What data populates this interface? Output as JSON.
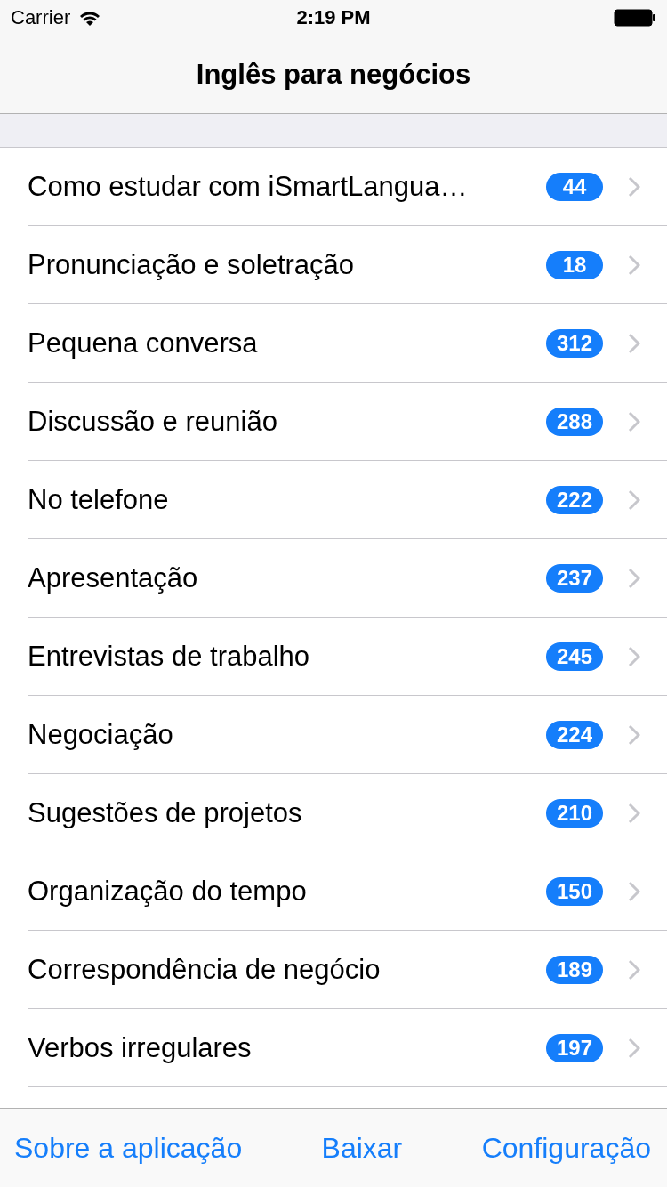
{
  "status_bar": {
    "carrier": "Carrier",
    "time": "2:19 PM"
  },
  "nav_bar": {
    "title": "Inglês para negócios"
  },
  "list": [
    {
      "label": "Como estudar com iSmartLangua…",
      "count": "44"
    },
    {
      "label": "Pronunciação e soletração",
      "count": "18"
    },
    {
      "label": "Pequena conversa",
      "count": "312"
    },
    {
      "label": "Discussão e reunião",
      "count": "288"
    },
    {
      "label": "No telefone",
      "count": "222"
    },
    {
      "label": "Apresentação",
      "count": "237"
    },
    {
      "label": "Entrevistas de trabalho",
      "count": "245"
    },
    {
      "label": "Negociação",
      "count": "224"
    },
    {
      "label": "Sugestões de projetos",
      "count": "210"
    },
    {
      "label": "Organização do tempo",
      "count": "150"
    },
    {
      "label": "Correspondência de negócio",
      "count": "189"
    },
    {
      "label": "Verbos irregulares",
      "count": "197"
    }
  ],
  "toolbar": [
    "Sobre a aplicação",
    "Baixar",
    "Configuração"
  ]
}
